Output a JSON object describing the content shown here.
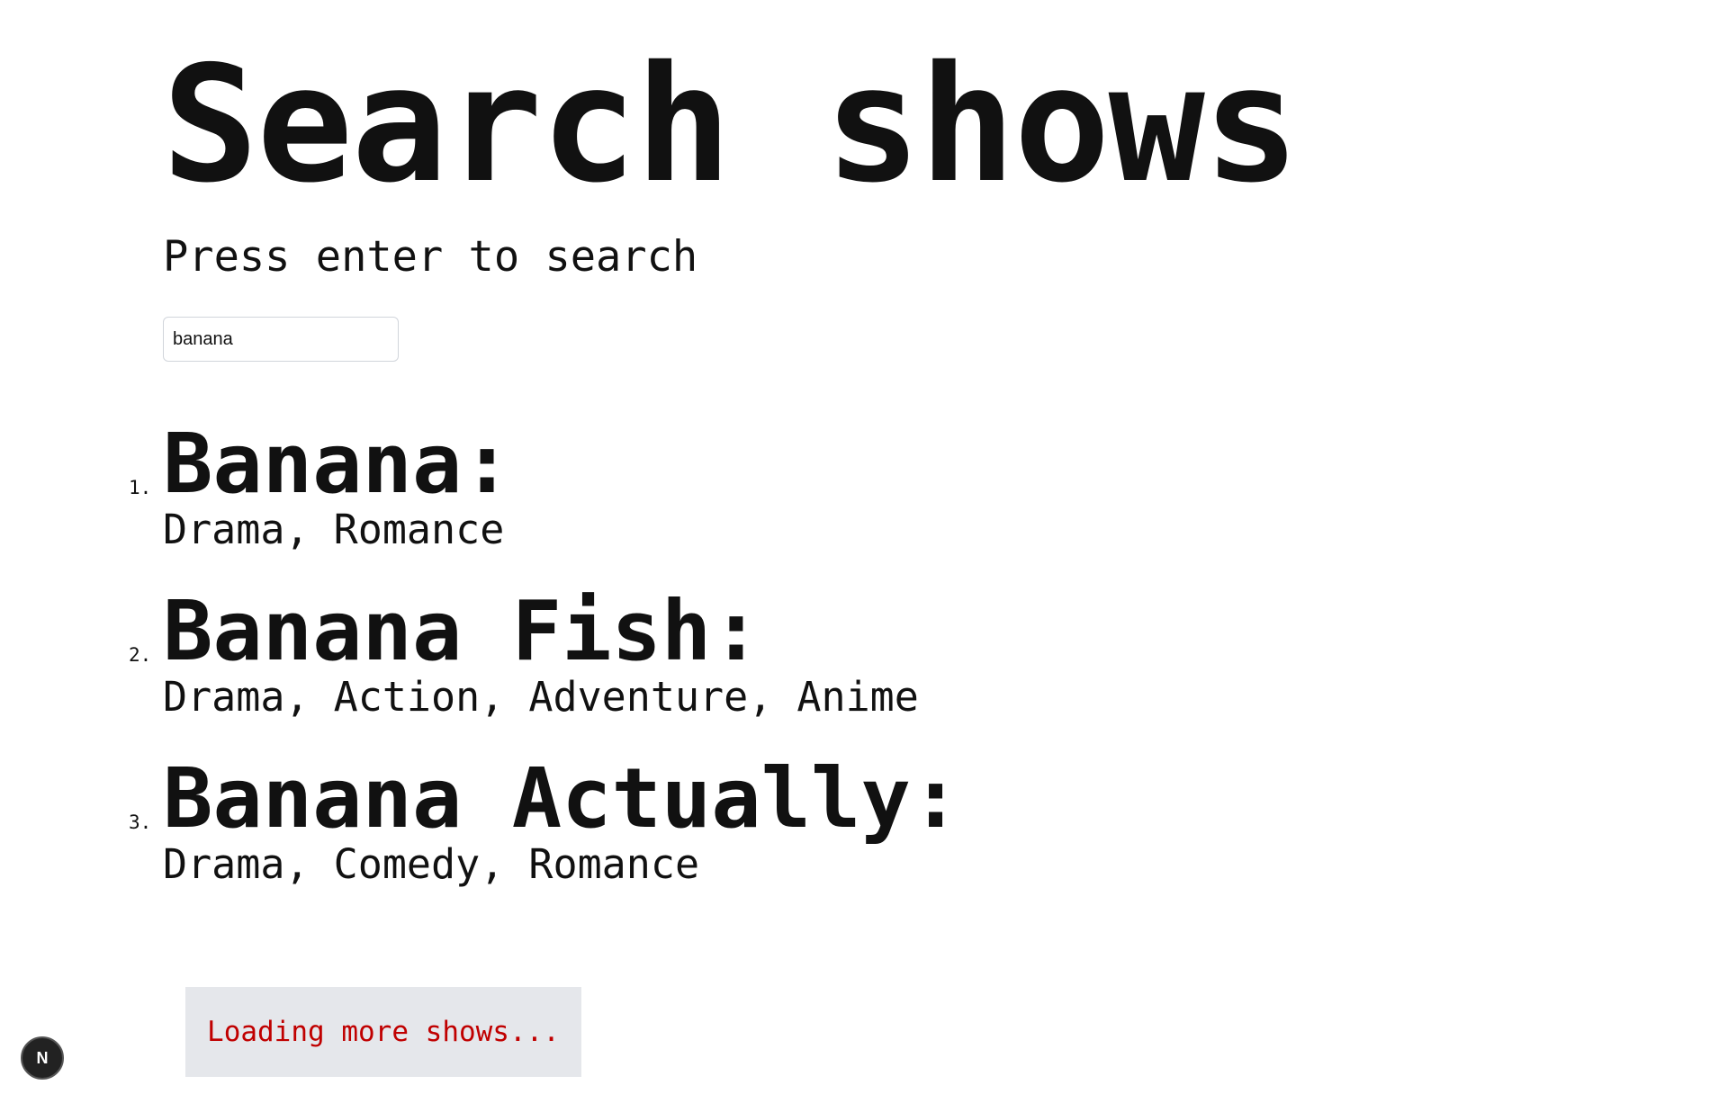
{
  "header": {
    "title": "Search shows",
    "subtitle": "Press enter to search"
  },
  "search": {
    "value": "banana"
  },
  "results": [
    {
      "number": "1.",
      "name": "Banana:",
      "genres": "Drama, Romance"
    },
    {
      "number": "2.",
      "name": "Banana Fish:",
      "genres": "Drama, Action, Adventure, Anime"
    },
    {
      "number": "3.",
      "name": "Banana Actually:",
      "genres": "Drama, Comedy, Romance"
    }
  ],
  "status": {
    "loading_text": "Loading more shows..."
  },
  "dev_badge": {
    "label": "N",
    "icon": "nextjs-logo-icon"
  },
  "colors": {
    "text": "#111111",
    "loading_text": "#c00000",
    "loading_bg": "#e5e7eb",
    "badge_bg": "#222222"
  }
}
